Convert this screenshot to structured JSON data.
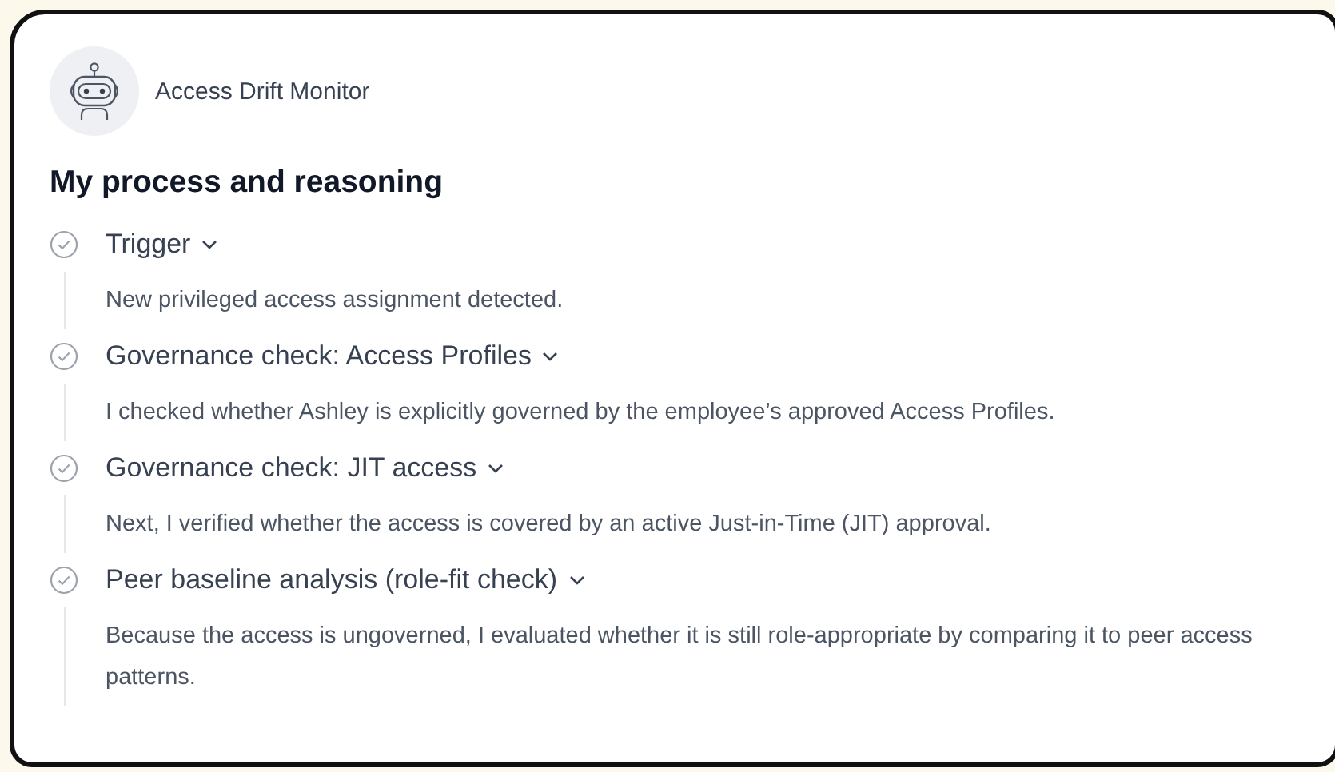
{
  "agent": {
    "name": "Access Drift Monitor"
  },
  "heading": "My process and reasoning",
  "steps": [
    {
      "title": "Trigger",
      "completed": true,
      "expanded": true,
      "detail": "New privileged access assignment detected."
    },
    {
      "title": "Governance check: Access Profiles",
      "completed": true,
      "expanded": true,
      "detail": "I checked whether Ashley is explicitly governed by the employee’s approved Access Profiles."
    },
    {
      "title": "Governance check: JIT access",
      "completed": true,
      "expanded": true,
      "detail": "Next, I verified whether the access is covered by an active Just-in-Time (JIT) approval."
    },
    {
      "title": "Peer baseline analysis (role-fit check)",
      "completed": true,
      "expanded": true,
      "detail": "Because the access is ungoverned, I evaluated whether it is still role-appropriate by comparing it to peer access patterns."
    }
  ]
}
